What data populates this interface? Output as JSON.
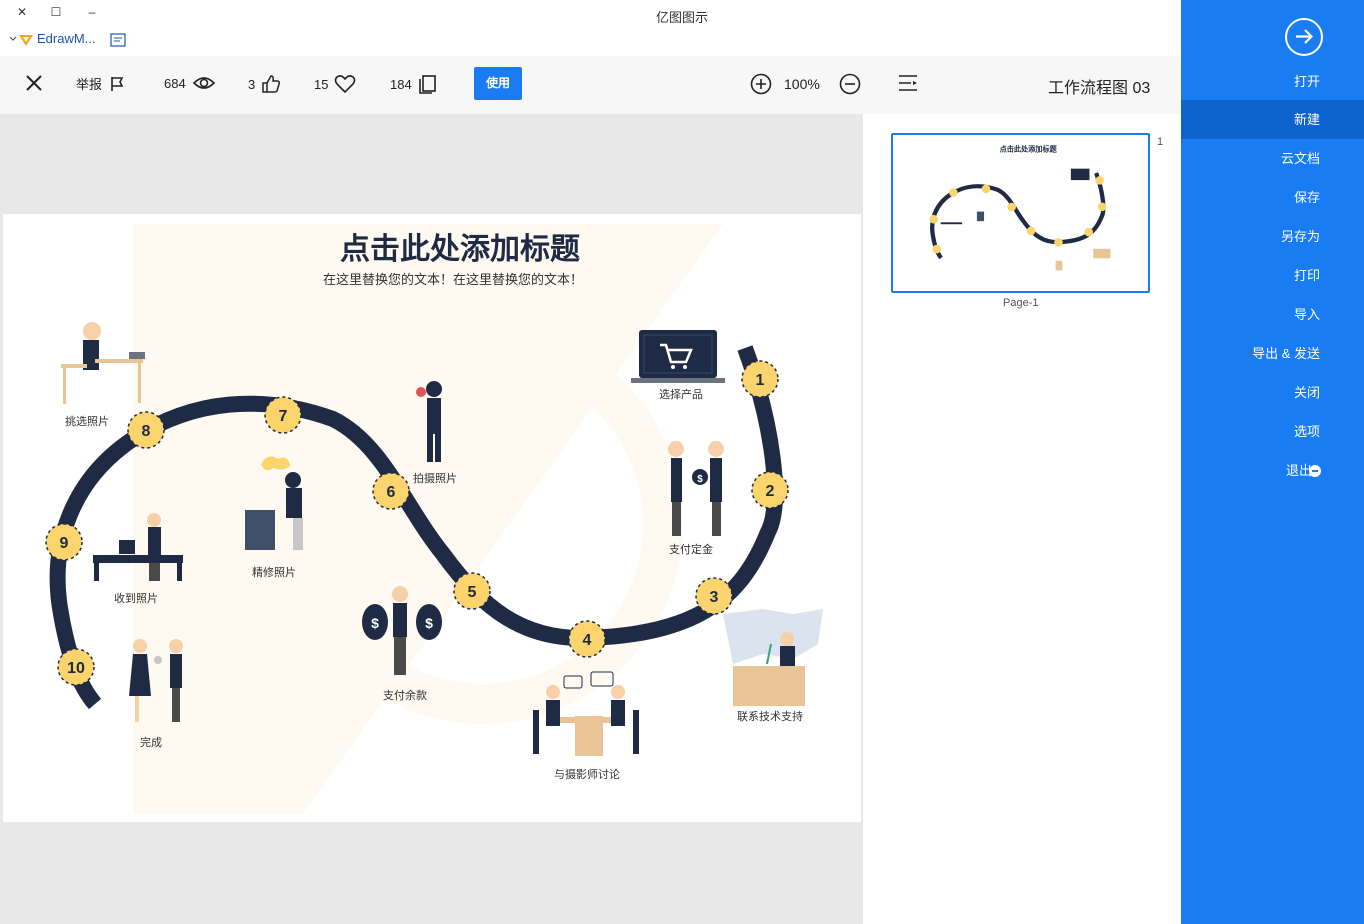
{
  "window": {
    "title": "亿图图示",
    "min": "–",
    "max": "☐",
    "close": "✕"
  },
  "bookmark": {
    "label": "EdrawM..."
  },
  "toolbar": {
    "close": "✕",
    "report": "举报",
    "views": "684",
    "likes": "3",
    "favorites": "15",
    "copies": "184",
    "use": "使用",
    "zoom": "100%",
    "doc_title": "工作流程图 03"
  },
  "sidebar": {
    "items": [
      {
        "label": "打开"
      },
      {
        "label": "新建"
      },
      {
        "label": "云文档"
      },
      {
        "label": "保存"
      },
      {
        "label": "另存为"
      },
      {
        "label": "打印"
      },
      {
        "label": "导入"
      },
      {
        "label": "导出 & 发送"
      },
      {
        "label": "关闭"
      },
      {
        "label": "选项"
      },
      {
        "label": "退出"
      }
    ]
  },
  "thumbnail": {
    "page_label": "Page-1",
    "page_number": "1"
  },
  "diagram": {
    "title": "点击此处添加标题",
    "subtitle": "在这里替换您的文本！在这里替换您的文本！",
    "steps": [
      {
        "num": "1",
        "label": "选择产品"
      },
      {
        "num": "2",
        "label": "支付定金"
      },
      {
        "num": "3",
        "label": "联系技术支持"
      },
      {
        "num": "4",
        "label": "与摄影师讨论"
      },
      {
        "num": "5",
        "label": "支付余款"
      },
      {
        "num": "6",
        "label": "拍摄照片"
      },
      {
        "num": "7",
        "label": "精修照片"
      },
      {
        "num": "8",
        "label": "挑选照片"
      },
      {
        "num": "9",
        "label": "收到照片"
      },
      {
        "num": "10",
        "label": "完成"
      }
    ]
  },
  "colors": {
    "accent": "#1a7cf2",
    "navy": "#1f2a44",
    "circle": "#fbd46d"
  }
}
